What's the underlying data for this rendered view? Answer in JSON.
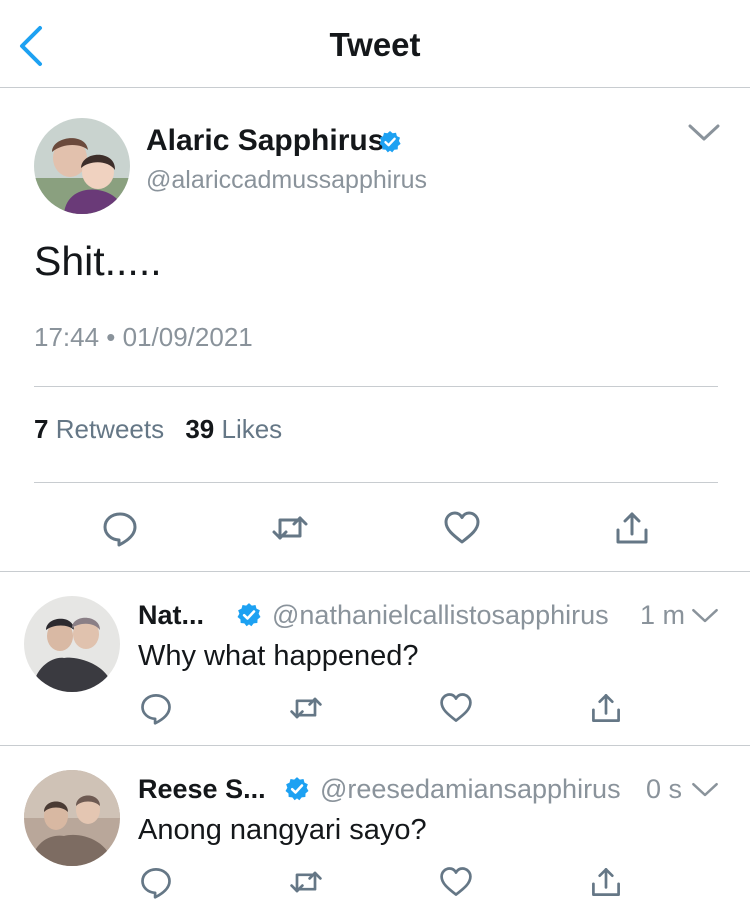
{
  "nav": {
    "title": "Tweet",
    "accent": "#1da1f2"
  },
  "tweet": {
    "author_name": "Alaric Sapphirus",
    "handle": "@alariccadmussapphirus",
    "verified": true,
    "text": "Shit.....",
    "timestamp": "17:44 • 01/09/2021",
    "retweets_count": "7",
    "retweets_label": "Retweets",
    "likes_count": "39",
    "likes_label": "Likes",
    "actions": [
      "reply-icon",
      "retweet-icon",
      "like-icon",
      "share-icon"
    ]
  },
  "replies": [
    {
      "author_name": "Nat...",
      "handle": "@nathanielcallistosapphirus",
      "time": "1 m",
      "verified": true,
      "text": "Why what happened?"
    },
    {
      "author_name": "Reese S...",
      "handle": "@reesedamiansapphirus",
      "time": "0 s",
      "verified": true,
      "text": "Anong nangyari sayo?"
    }
  ],
  "colors": {
    "verified": "#1da1f2",
    "muted_text": "#8a939b",
    "divider": "#c8ccd0",
    "icon": "#657786"
  }
}
